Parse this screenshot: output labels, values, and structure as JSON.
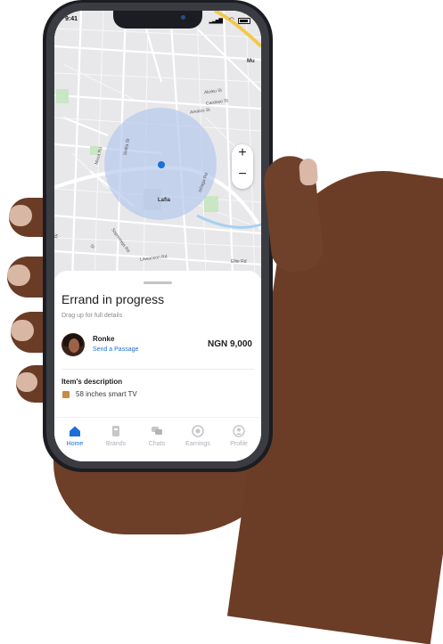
{
  "status_bar": {
    "time": "9:41"
  },
  "map": {
    "labels": {
      "mu": "Mu",
      "akoku": "Akoku St",
      "cardoso": "Cardoso St",
      "amaizu": "Amaizu St",
      "musa": "Musa Rd",
      "shitta": "Shitta St",
      "ishaga": "Ishaga Rd",
      "lafia": "Lafia",
      "dr": "Dr",
      "st": "St",
      "sopra": "Sopremeja Rd",
      "lawanson": "Lawanson Rd",
      "elite": "Elite Rd"
    },
    "accent_color": "#1a6fd8",
    "zoom_in": "+",
    "zoom_out": "−"
  },
  "sheet": {
    "title": "Errand in progress",
    "subtitle": "Drag up for full details",
    "rider_name": "Ronke",
    "rider_action": "Send a Passage",
    "price": "NGN 9,000",
    "description_title": "Item's description",
    "item": "58 inches smart TV"
  },
  "tabs": [
    {
      "label": "Home",
      "icon": "home-icon",
      "active": true
    },
    {
      "label": "Brands",
      "icon": "brands-icon"
    },
    {
      "label": "Chats",
      "icon": "chats-icon"
    },
    {
      "label": "Earnings",
      "icon": "earnings-icon"
    },
    {
      "label": "Profile",
      "icon": "profile-icon"
    }
  ]
}
